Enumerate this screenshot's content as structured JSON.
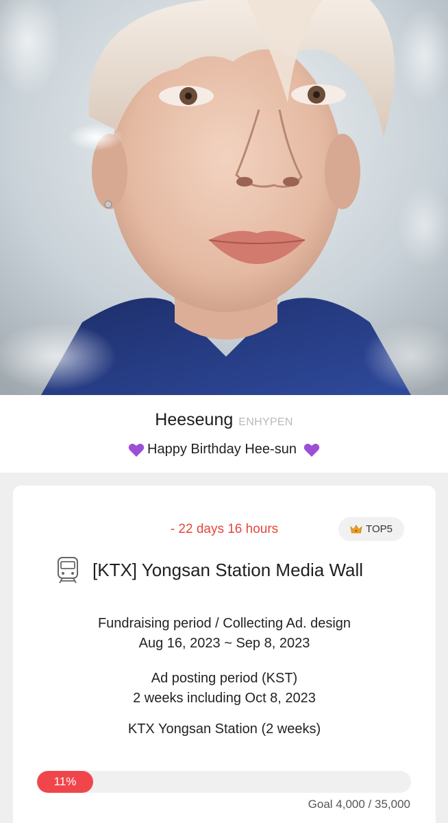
{
  "hero": {
    "image": "portrait-photo"
  },
  "artist": {
    "name": "Heeseung",
    "group": "ENHYPEN",
    "message": "Happy Birthday Hee-sun",
    "message_icon": "purple-heart-icon"
  },
  "campaign": {
    "countdown": "- 22 days 16 hours",
    "badge": {
      "icon": "crown-icon",
      "label": "TOP5"
    },
    "title_icon": "train-icon",
    "title": "[KTX] Yongsan Station Media Wall",
    "fundraising_label": "Fundraising period / Collecting Ad. design",
    "fundraising_dates": "Aug 16, 2023 ~ Sep 8, 2023",
    "posting_label": "Ad posting period (KST)",
    "posting_dates": "2 weeks including Oct 8, 2023",
    "location": "KTX Yongsan Station (2 weeks)",
    "progress_percent": 11,
    "progress_label": "11%",
    "goal_text": "Goal 4,000 / 35,000"
  },
  "colors": {
    "accent_red": "#f0464b",
    "countdown_red": "#e2473c",
    "heart_purple": "#9b4fd6",
    "crown_gold": "#e8a21c"
  }
}
